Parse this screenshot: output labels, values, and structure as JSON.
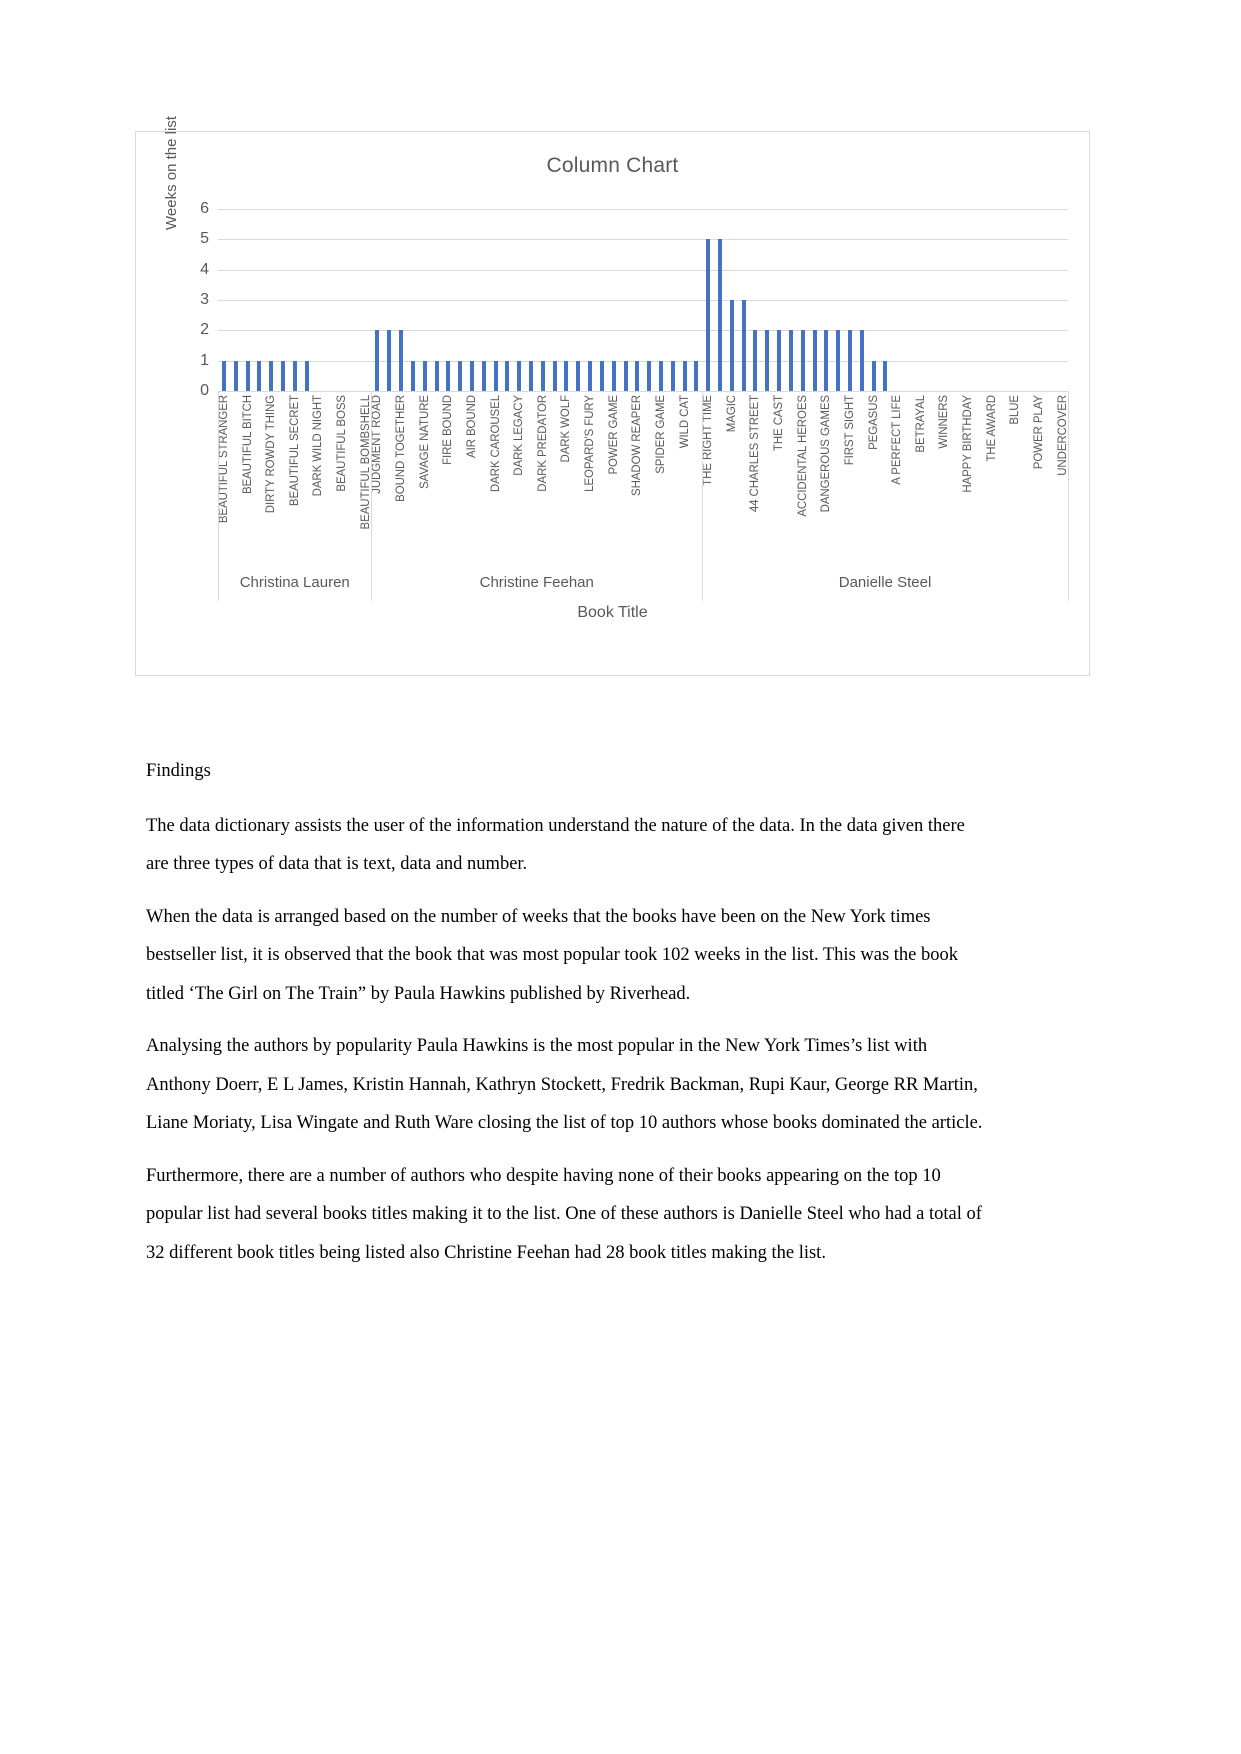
{
  "chart_data": {
    "type": "bar",
    "title": "Column Chart",
    "xlabel": "Book Title",
    "ylabel": "Weeks on the list",
    "ylim": [
      0,
      6
    ],
    "yticks": [
      6,
      5,
      4,
      3,
      2,
      1,
      0
    ],
    "grid": true,
    "legend": "none",
    "bar_color": "#4472c4",
    "groups": [
      {
        "name": "Christina Lauren",
        "categories": [
          "BEAUTIFUL STRANGER",
          "",
          "BEAUTIFUL BITCH",
          "",
          "DIRTY ROWDY THING",
          "",
          "BEAUTIFUL SECRET",
          "",
          "DARK WILD NIGHT",
          "",
          "BEAUTIFUL BOSS",
          "",
          "BEAUTIFUL BOMBSHELL"
        ],
        "values": [
          1,
          1,
          1,
          1,
          1,
          1,
          1,
          1,
          0,
          0,
          0,
          0,
          0
        ]
      },
      {
        "name": "Christine Feehan",
        "categories": [
          "JUDGMENT ROAD",
          "",
          "BOUND TOGETHER",
          "",
          "SAVAGE NATURE",
          "",
          "FIRE BOUND",
          "",
          "AIR BOUND",
          "",
          "DARK CAROUSEL",
          "",
          "DARK LEGACY",
          "",
          "DARK PREDATOR",
          "",
          "DARK WOLF",
          "",
          "LEOPARD'S FURY",
          "",
          "POWER GAME",
          "",
          "SHADOW REAPER",
          "",
          "SPIDER GAME",
          "",
          "WILD CAT",
          ""
        ],
        "values": [
          2,
          2,
          2,
          1,
          1,
          1,
          1,
          1,
          1,
          1,
          1,
          1,
          1,
          1,
          1,
          1,
          1,
          1,
          1,
          1,
          1,
          1,
          1,
          1,
          1,
          1,
          1,
          1
        ]
      },
      {
        "name": "Danielle Steel",
        "categories": [
          "THE RIGHT TIME",
          "",
          "MAGIC",
          "",
          "44 CHARLES STREET",
          "",
          "THE CAST",
          "",
          "ACCIDENTAL HEROES",
          "",
          "DANGEROUS GAMES",
          "",
          "FIRST SIGHT",
          "",
          "PEGASUS",
          "",
          "A PERFECT LIFE",
          "",
          "BETRAYAL",
          "",
          "WINNERS",
          "",
          "HAPPY BIRTHDAY",
          "",
          "THE AWARD",
          "",
          "BLUE",
          "",
          "POWER PLAY",
          "",
          "UNDERCOVER"
        ],
        "values": [
          5,
          5,
          3,
          3,
          2,
          2,
          2,
          2,
          2,
          2,
          2,
          2,
          2,
          2,
          1,
          1,
          0,
          0,
          0,
          0,
          0,
          0,
          0,
          0,
          0,
          0,
          0,
          0,
          0,
          0,
          0
        ]
      }
    ]
  },
  "document": {
    "heading": "Findings",
    "paragraphs": [
      "The data dictionary assists the user of the information understand the nature of the data. In the data given there are three types of data that is text, data and number.",
      "When the data is arranged based on the number of weeks that the books have been on the New York times bestseller list, it is observed that the book that was most popular took 102 weeks in the list. This was the book titled ‘The Girl on The Train” by Paula Hawkins published by Riverhead.",
      "Analysing the authors by popularity Paula Hawkins is the most popular in the New York Times’s list with Anthony Doerr, E L James, Kristin Hannah, Kathryn Stockett, Fredrik Backman, Rupi Kaur, George RR Martin, Liane Moriaty, Lisa Wingate and Ruth Ware closing the list of top 10 authors whose books dominated the article.",
      "Furthermore, there are a number of authors who despite having none of their books appearing on the top 10 popular list had several books titles making it to the list. One of these authors is Danielle Steel who had a total of 32 different book titles being listed also Christine Feehan had 28 book titles making the list."
    ]
  }
}
